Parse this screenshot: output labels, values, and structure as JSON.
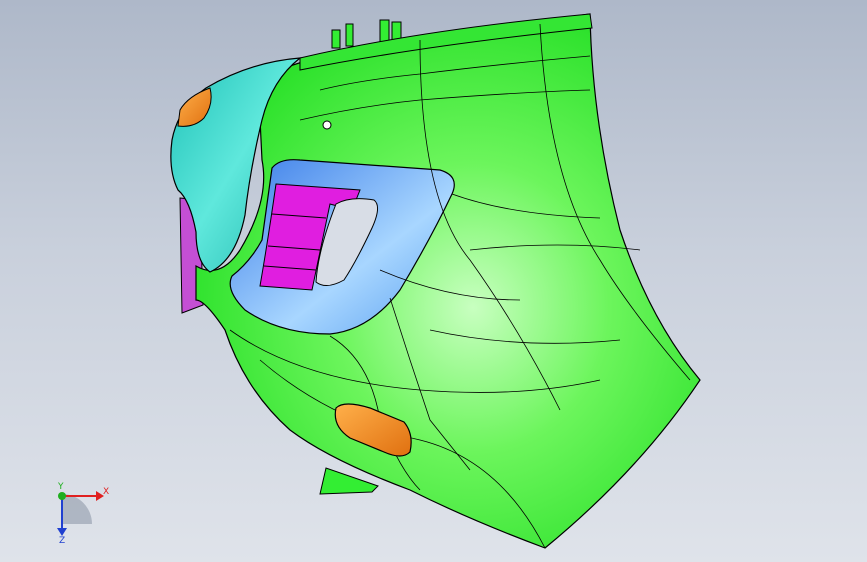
{
  "viewport": {
    "background_top": "#aeb8c9",
    "background_bottom": "#dfe3ea"
  },
  "model": {
    "part_colors": {
      "main_body": "#33ee33",
      "main_body_highlight": "#c8ffc0",
      "upper_bezel": "#2ad6c8",
      "inner_trim": "#7ec8ff",
      "grille_insert": "#e01ee0",
      "side_bracket": "#c44fd4",
      "reflector": "#f08a1c",
      "edge_lines": "#000000"
    }
  },
  "triad": {
    "x_label": "X",
    "y_label": "Y",
    "z_label": "Z",
    "x_color": "#e02020",
    "y_color": "#1fae1f",
    "z_color": "#2040d0"
  }
}
